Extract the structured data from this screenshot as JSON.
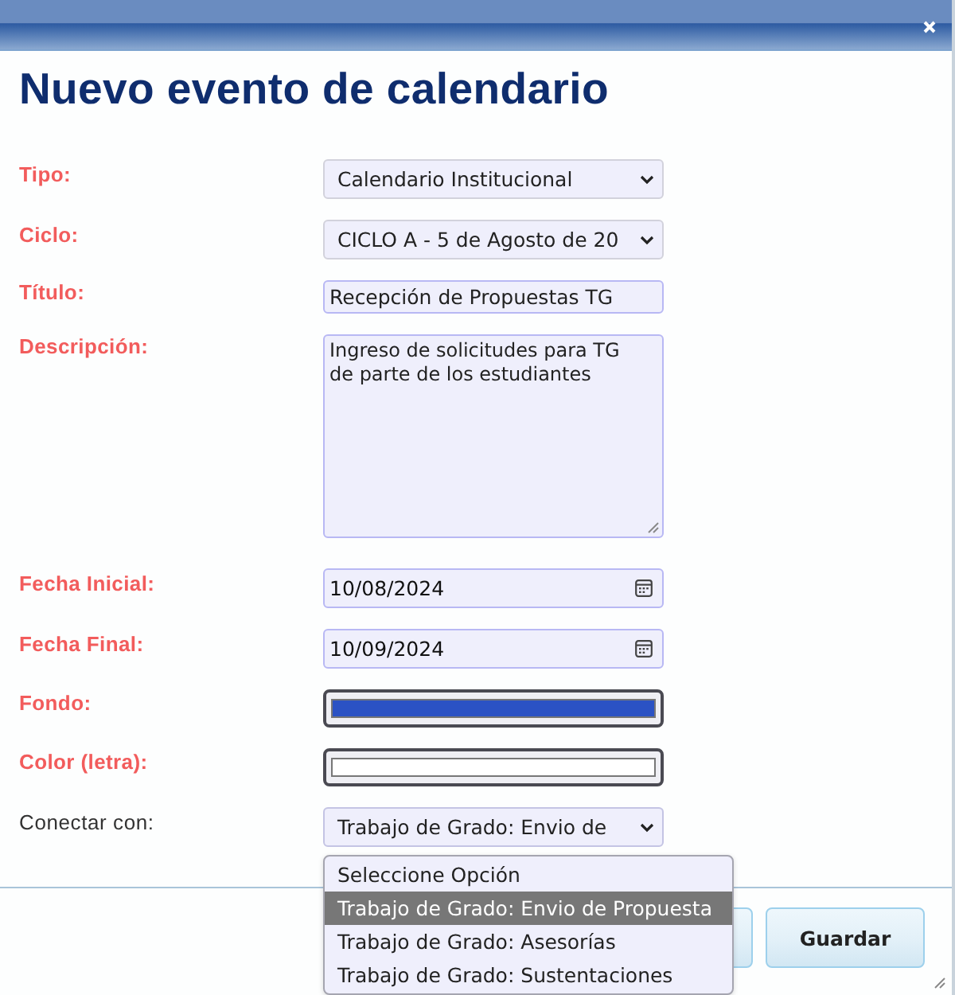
{
  "window": {
    "title": "Nuevo evento de calendario"
  },
  "fields": [
    {
      "kind": "select",
      "label": "Tipo:",
      "required": true,
      "value": "Calendario Institucional",
      "expanded": false
    },
    {
      "kind": "select",
      "label": "Ciclo:",
      "required": true,
      "value": "CICLO A - 5 de Agosto de 20",
      "expanded": false
    },
    {
      "kind": "text",
      "label": "Título:",
      "required": true,
      "value": "Recepción de Propuestas TG"
    },
    {
      "kind": "textarea",
      "label": "Descripción:",
      "required": true,
      "value": "Ingreso de solicitudes para TG de parte de los estudiantes"
    },
    {
      "kind": "date",
      "label": "Fecha Inicial:",
      "required": true,
      "value": "10/08/2024"
    },
    {
      "kind": "date",
      "label": "Fecha Final:",
      "required": true,
      "value": "10/09/2024"
    },
    {
      "kind": "color",
      "label": "Fondo:",
      "required": true,
      "color": "#2b52c4"
    },
    {
      "kind": "color",
      "label": "Color (letra):",
      "required": true,
      "color": "#ffffff"
    },
    {
      "kind": "select",
      "label": "Conectar con:",
      "required": false,
      "value": "Trabajo de Grado: Envio de",
      "expanded": true,
      "options": [
        {
          "label": "Seleccione Opción",
          "selected": false
        },
        {
          "label": "Trabajo de Grado: Envio de Propuesta",
          "selected": true
        },
        {
          "label": "Trabajo de Grado: Asesorías",
          "selected": false
        },
        {
          "label": "Trabajo de Grado: Sustentaciones",
          "selected": false
        }
      ]
    }
  ],
  "buttons": [
    {
      "kind": "covered"
    },
    {
      "kind": "text",
      "label": "Guardar"
    }
  ]
}
